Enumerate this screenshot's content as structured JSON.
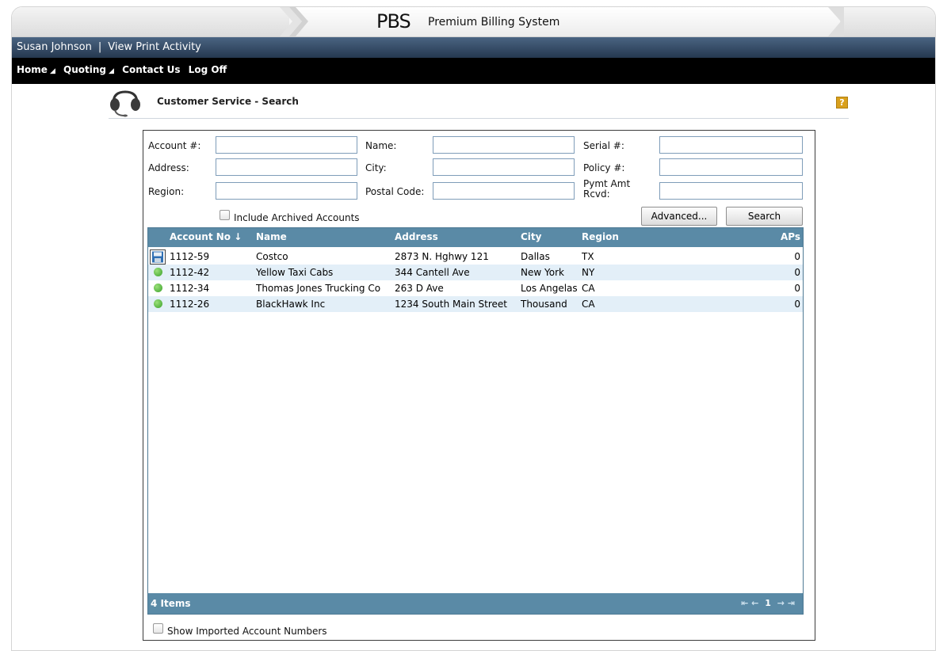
{
  "brand": {
    "logo": "PBS",
    "title": "Premium Billing System"
  },
  "userbar": {
    "user_name": "Susan Johnson",
    "separator": "|",
    "print_activity": "View Print Activity"
  },
  "nav": {
    "home": "Home",
    "quoting": "Quoting",
    "contact": "Contact Us",
    "logoff": "Log Off"
  },
  "page": {
    "title": "Customer Service - Search",
    "help": "?"
  },
  "form": {
    "account_label": "Account #:",
    "name_label": "Name:",
    "serial_label": "Serial #:",
    "address_label": "Address:",
    "city_label": "City:",
    "policy_label": "Policy #:",
    "region_label": "Region:",
    "postal_label": "Postal Code:",
    "pymt_label_1": "Pymt Amt",
    "pymt_label_2": "Rcvd:",
    "archived_label": "Include Archived Accounts",
    "advanced_button": "Advanced...",
    "search_button": "Search",
    "imported_label": "Show Imported Account Numbers"
  },
  "grid": {
    "headers": {
      "account": "Account No",
      "sort_arrow": "↓",
      "name": "Name",
      "address": "Address",
      "city": "City",
      "region": "Region",
      "aps": "APs"
    },
    "rows": [
      {
        "account": "1112-59",
        "name": "Costco",
        "address": "2873 N. Hghwy 121",
        "city": "Dallas",
        "region": "TX",
        "aps": "0"
      },
      {
        "account": "1112-42",
        "name": "Yellow Taxi Cabs",
        "address": "344 Cantell Ave",
        "city": "New York",
        "region": "NY",
        "aps": "0"
      },
      {
        "account": "1112-34",
        "name": "Thomas Jones Trucking Co",
        "address": "263 D Ave",
        "city": "Los Angelas",
        "region": "CA",
        "aps": "0"
      },
      {
        "account": "1112-26",
        "name": "BlackHawk Inc",
        "address": "1234 South Main Street",
        "city": "Thousand ...",
        "region": "CA",
        "aps": "0"
      }
    ],
    "footer": {
      "count": "4 Items",
      "page": "1",
      "first": "⇤",
      "prev": "←",
      "next": "→",
      "last": "⇥"
    }
  },
  "colors": {
    "accent": "#5a8aa6",
    "alt_row": "#e3eff8",
    "status_active": "#3aa12a"
  }
}
